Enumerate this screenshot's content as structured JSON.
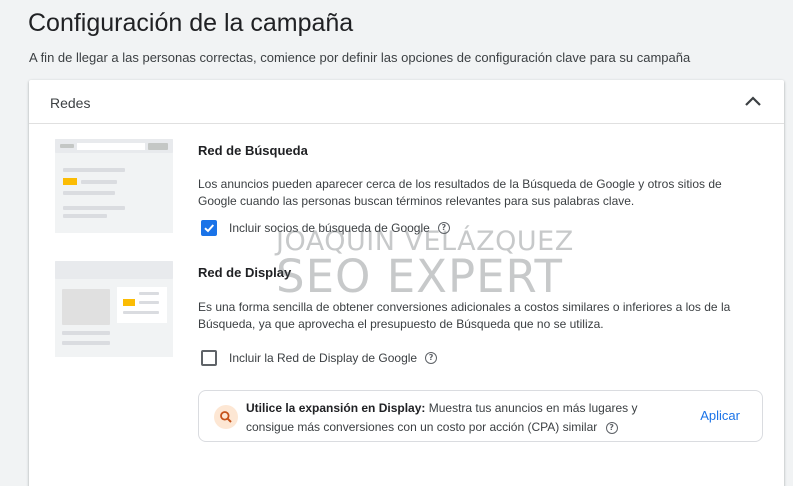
{
  "page": {
    "title": "Configuración de la campaña",
    "subtitle": "A fin de llegar a las personas correctas, comience por definir las opciones de configuración clave para su campaña"
  },
  "card": {
    "title": "Redes",
    "collapse_icon": "chevron-up-icon"
  },
  "search_network": {
    "title": "Red de Búsqueda",
    "description": "Los anuncios pueden aparecer cerca de los resultados de la Búsqueda de Google y otros sitios de Google cuando las personas buscan términos relevantes para sus palabras clave.",
    "checkbox_label": "Incluir socios de búsqueda de Google",
    "checked": true
  },
  "display_network": {
    "title": "Red de Display",
    "description": "Es una forma sencilla de obtener conversiones adicionales a costos similares o inferiores a los de la Búsqueda, ya que aprovecha el presupuesto de Búsqueda que no se utiliza.",
    "checkbox_label": "Incluir la Red de Display de Google",
    "checked": false
  },
  "watermark": {
    "line1": "JOAQUIN VELÁZQUEZ",
    "line2": "SEO EXPERT"
  },
  "promo": {
    "icon": "search-icon",
    "bold": "Utilice la expansión en Display:",
    "text": " Muestra tus anuncios en más lugares y consigue más conversiones con un costo por acción (CPA) similar",
    "action": "Aplicar"
  },
  "colors": {
    "accent": "#1a73e8",
    "highlight": "#fbbc04",
    "promo_icon_bg": "#fde7d4"
  }
}
